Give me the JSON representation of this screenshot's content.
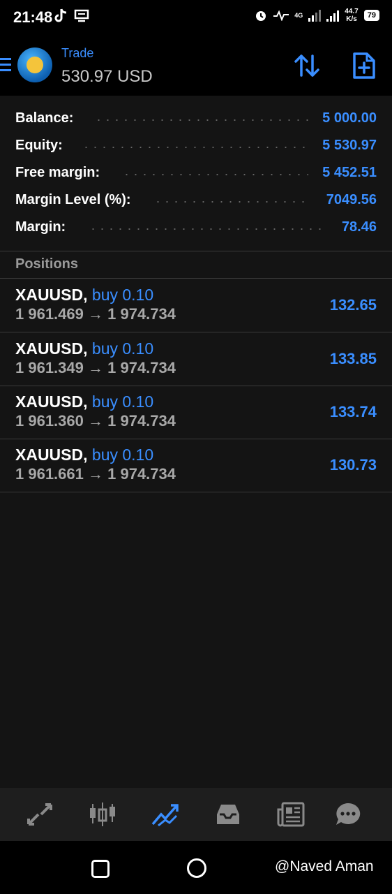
{
  "status_bar": {
    "time": "21:48",
    "net_speed_value": "44.7",
    "net_speed_unit": "K/s",
    "network": "4G",
    "battery": "79"
  },
  "header": {
    "subtitle": "Trade",
    "balance": "530.97 USD"
  },
  "summary": [
    {
      "label": "Balance:",
      "value": "5 000.00"
    },
    {
      "label": "Equity:",
      "value": "5 530.97"
    },
    {
      "label": "Free margin:",
      "value": "5 452.51"
    },
    {
      "label": "Margin Level (%):",
      "value": "7049.56"
    },
    {
      "label": "Margin:",
      "value": "78.46"
    }
  ],
  "positions_title": "Positions",
  "positions": [
    {
      "symbol": "XAUUSD,",
      "type": "buy 0.10",
      "open": "1 961.469",
      "arrow": "→",
      "current": "1 974.734",
      "profit": "132.65"
    },
    {
      "symbol": "XAUUSD,",
      "type": "buy 0.10",
      "open": "1 961.349",
      "arrow": "→",
      "current": "1 974.734",
      "profit": "133.85"
    },
    {
      "symbol": "XAUUSD,",
      "type": "buy 0.10",
      "open": "1 961.360",
      "arrow": "→",
      "current": "1 974.734",
      "profit": "133.74"
    },
    {
      "symbol": "XAUUSD,",
      "type": "buy 0.10",
      "open": "1 961.661",
      "arrow": "→",
      "current": "1 974.734",
      "profit": "130.73"
    }
  ],
  "bottom_nav": [
    "quotes-icon",
    "chart-icon",
    "trade-icon",
    "history-icon",
    "news-icon",
    "messages-icon"
  ],
  "watermark": "@Naved Aman",
  "colors": {
    "accent": "#3a8eff",
    "background": "#141414"
  }
}
